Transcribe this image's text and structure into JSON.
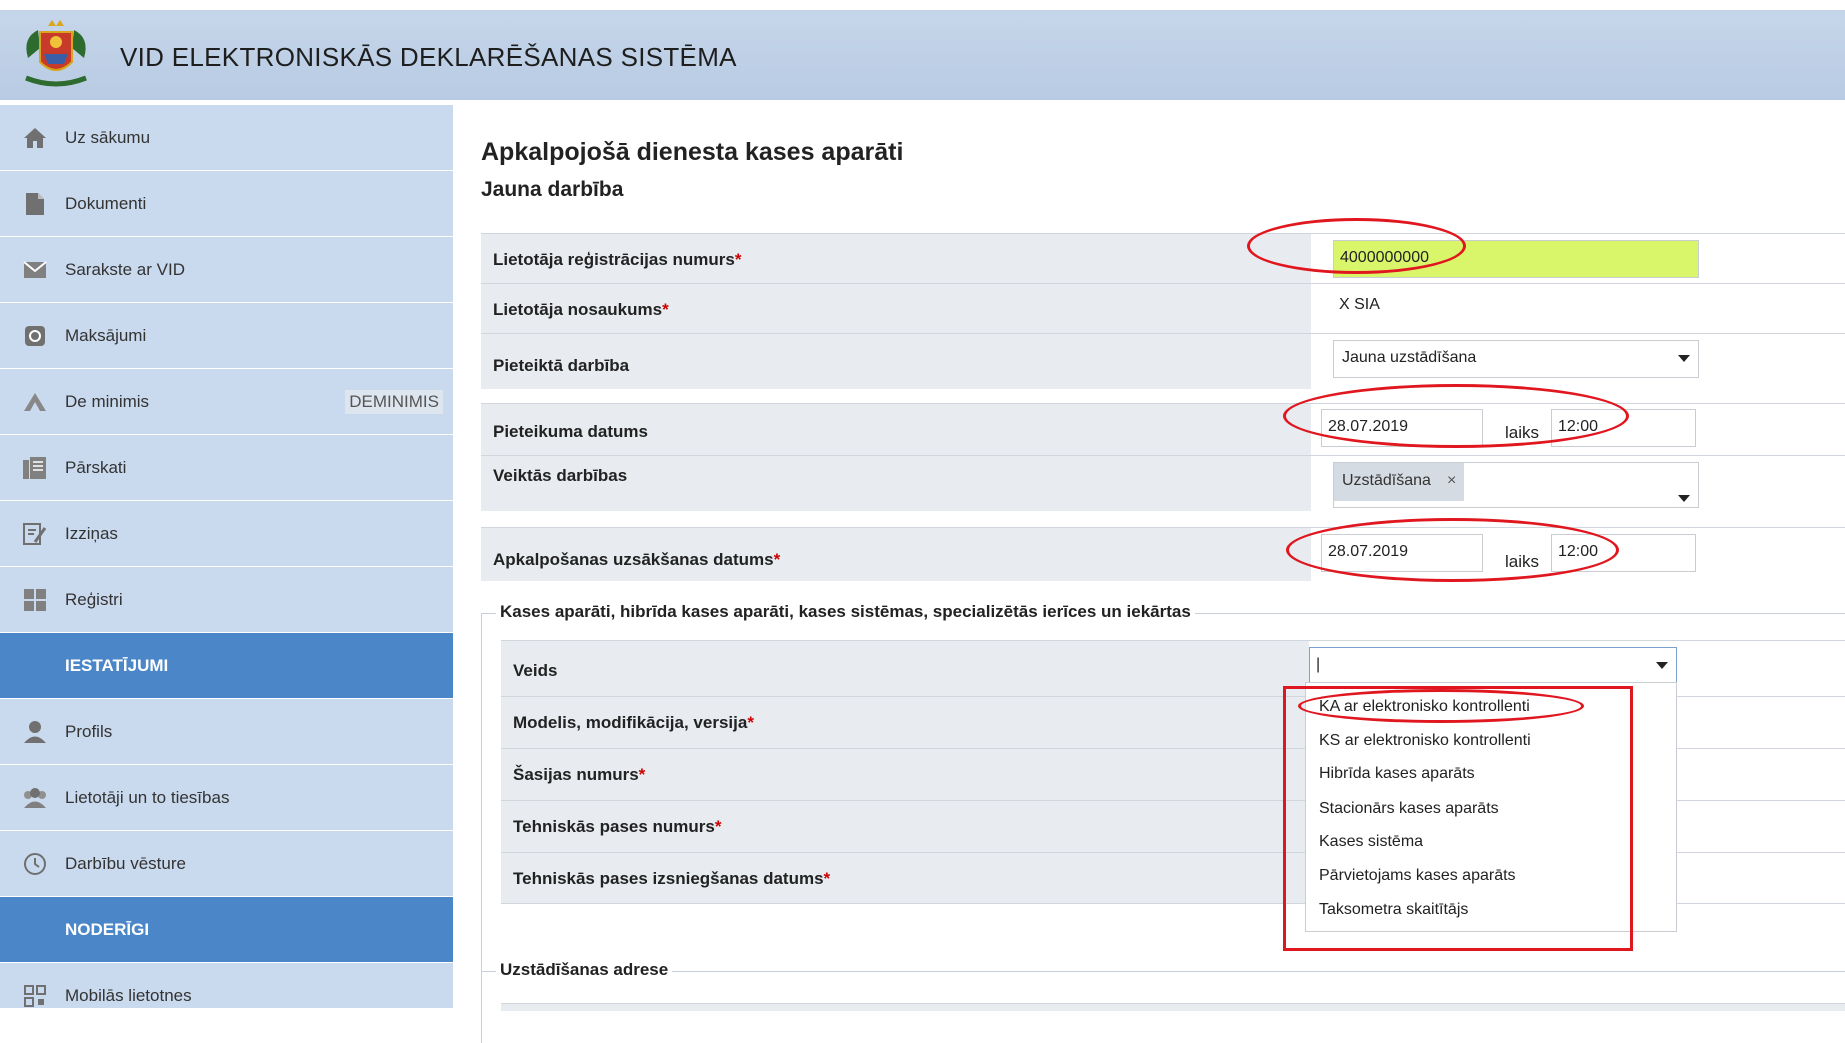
{
  "header": {
    "title": "VID ELEKTRONISKĀS DEKLARĒŠANAS SISTĒMA"
  },
  "sidebar": {
    "items": [
      {
        "label": "Uz sākumu",
        "icon": "home-icon"
      },
      {
        "label": "Dokumenti",
        "icon": "document-icon"
      },
      {
        "label": "Sarakste ar VID",
        "icon": "envelope-icon"
      },
      {
        "label": "Maksājumi",
        "icon": "payment-icon"
      },
      {
        "label": "De minimis",
        "icon": "scales-icon",
        "badge": "DEMINIMIS"
      },
      {
        "label": "Pārskati",
        "icon": "reports-icon"
      },
      {
        "label": "Izziņas",
        "icon": "certificate-icon"
      },
      {
        "label": "Reģistri",
        "icon": "grid-icon"
      }
    ],
    "section_settings": "IESTATĪJUMI",
    "settings_items": [
      {
        "label": "Profils",
        "icon": "user-icon"
      },
      {
        "label": "Lietotāji un to tiesības",
        "icon": "users-icon"
      },
      {
        "label": "Darbību vēsture",
        "icon": "history-icon"
      }
    ],
    "section_useful": "NODERĪGI",
    "useful_items": [
      {
        "label": "Mobilās lietotnes",
        "icon": "qr-icon"
      }
    ]
  },
  "main": {
    "title": "Apkalpojošā dienesta kases aparāti",
    "subtitle": "Jauna darbība",
    "fields": {
      "reg_number": {
        "label": "Lietotāja reģistrācijas numurs",
        "required": "*",
        "value": "4000000000"
      },
      "user_name": {
        "label": "Lietotāja nosaukums",
        "required": "*",
        "value": "X SIA"
      },
      "action": {
        "label": "Pieteiktā darbība",
        "value": "Jauna uzstādīšana"
      },
      "application_date": {
        "label": "Pieteikuma datums",
        "date": "28.07.2019",
        "time_label": "laiks",
        "time": "12:00"
      },
      "performed_actions": {
        "label": "Veiktās darbības",
        "tag": "Uzstādīšana",
        "tag_remove": "×"
      },
      "service_start": {
        "label": "Apkalpošanas uzsākšanas datums",
        "required": "*",
        "date": "28.07.2019",
        "time_label": "laiks",
        "time": "12:00"
      }
    },
    "devices_section": {
      "legend": "Kases aparāti, hibrīda kases aparāti, kases sistēmas, specializētās ierīces un iekārtas",
      "type_label": "Veids",
      "type_value": "|",
      "model_label": "Modelis, modifikācija, versija",
      "chassis_label": "Šasijas numurs",
      "passport_label": "Tehniskās pases numurs",
      "passport_date_label": "Tehniskās pases izsniegšanas datums",
      "required": "*",
      "options": [
        "KA ar elektronisko kontrollenti",
        "KS ar elektronisko kontrollenti",
        "Hibrīda kases aparāts",
        "Stacionārs kases aparāts",
        "Kases sistēma",
        "Pārvietojams kases aparāts",
        "Taksometra skaitītājs"
      ]
    },
    "address_section": {
      "legend": "Uzstādīšanas adrese"
    }
  },
  "colors": {
    "sidebar_bg": "#c9d9ee",
    "section_bg": "#4a86c8",
    "highlight_input": "#d9f56a",
    "annotation_red": "#e0171f"
  }
}
